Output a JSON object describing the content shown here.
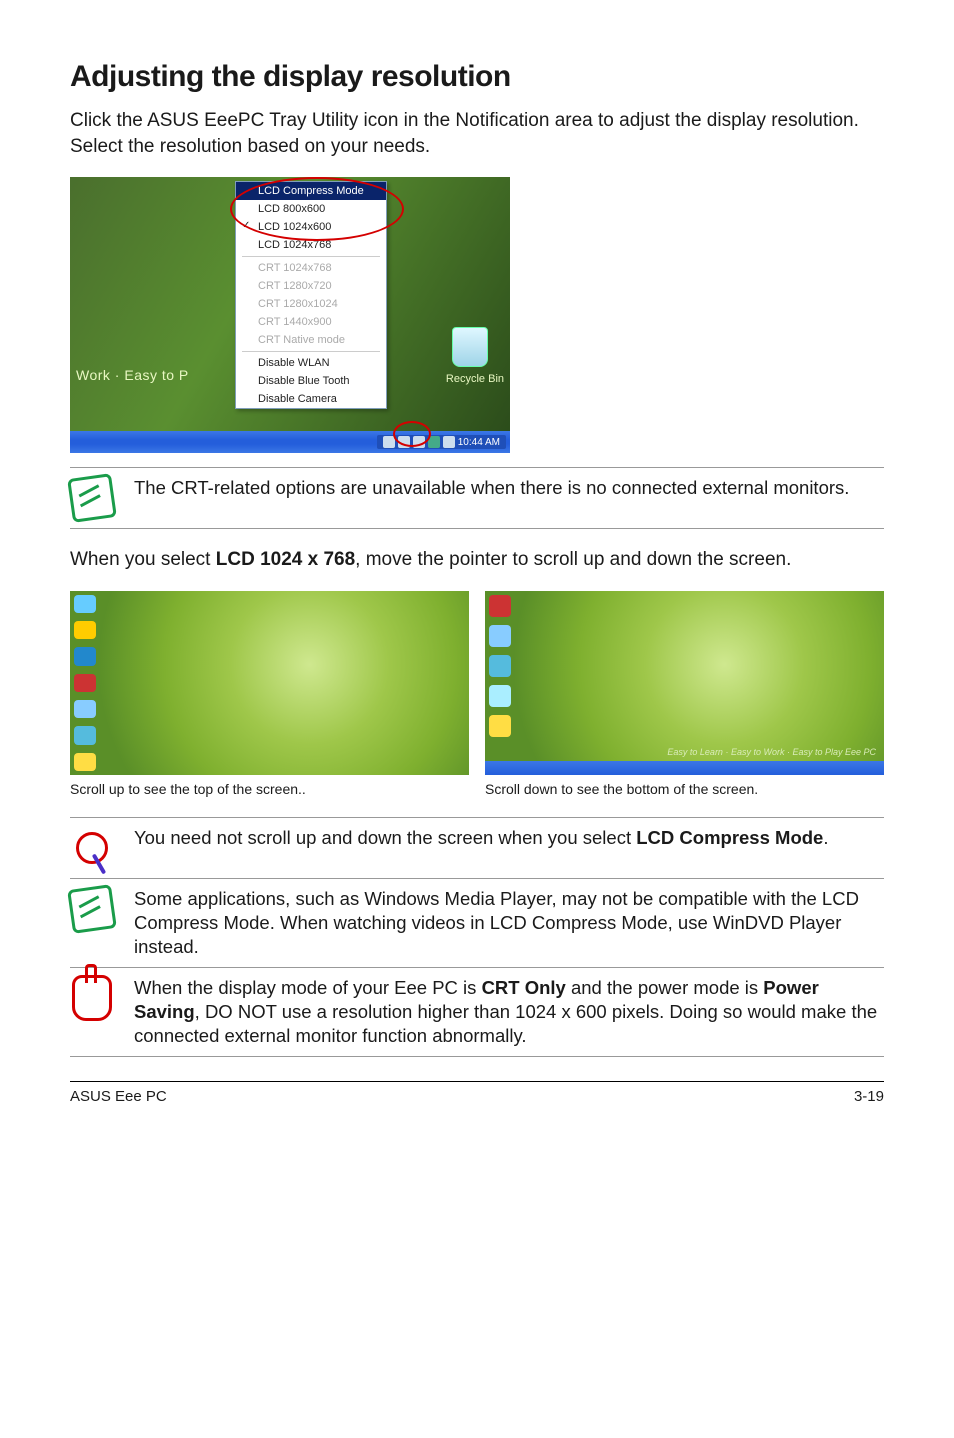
{
  "heading": "Adjusting the display resolution",
  "intro": "Click the ASUS EeePC Tray Utility icon in the Notification area to adjust the display resolution. Select the resolution based on your needs.",
  "tray_menu": {
    "sel": "LCD Compress Mode",
    "lcd": [
      "LCD 800x600",
      "LCD 1024x600",
      "LCD 1024x768"
    ],
    "checked_index": 1,
    "crt": [
      "CRT 1024x768",
      "CRT 1280x720",
      "CRT 1280x1024",
      "CRT 1440x900",
      "CRT Native mode"
    ],
    "disable": [
      "Disable WLAN",
      "Disable Blue Tooth",
      "Disable Camera"
    ],
    "easy_tag": "Work · Easy to P",
    "bin": "Recycle Bin",
    "clock": "10:44 AM"
  },
  "note1": "The CRT-related options are unavailable when there is no connected external monitors.",
  "mid_text_pre": "When you select ",
  "mid_text_bold": "LCD 1024 x 768",
  "mid_text_post": ", move the pointer to scroll up and down the screen.",
  "caption_left": "Scroll up to see the top of the screen..",
  "caption_right": "Scroll down to see the bottom of the screen.",
  "slogan": "Easy to Learn · Easy to Work · Easy to Play   Eee PC",
  "tip_pre": "You need not scroll up and down the screen when you select ",
  "tip_bold": "LCD Compress Mode",
  "tip_post": ".",
  "note2": "Some applications, such as Windows Media Player, may not be compatible with the LCD Compress Mode. When watching videos in LCD Compress Mode, use WinDVD Player instead.",
  "caution_1": "When the display mode of your Eee PC is ",
  "caution_b1": "CRT Only",
  "caution_2": " and the power mode is ",
  "caution_b2": "Power Saving",
  "caution_3": ", DO NOT use a resolution higher than 1024 x 600 pixels. Doing so would make the connected external monitor function abnormally.",
  "footer_left": "ASUS Eee PC",
  "footer_right": "3-19"
}
